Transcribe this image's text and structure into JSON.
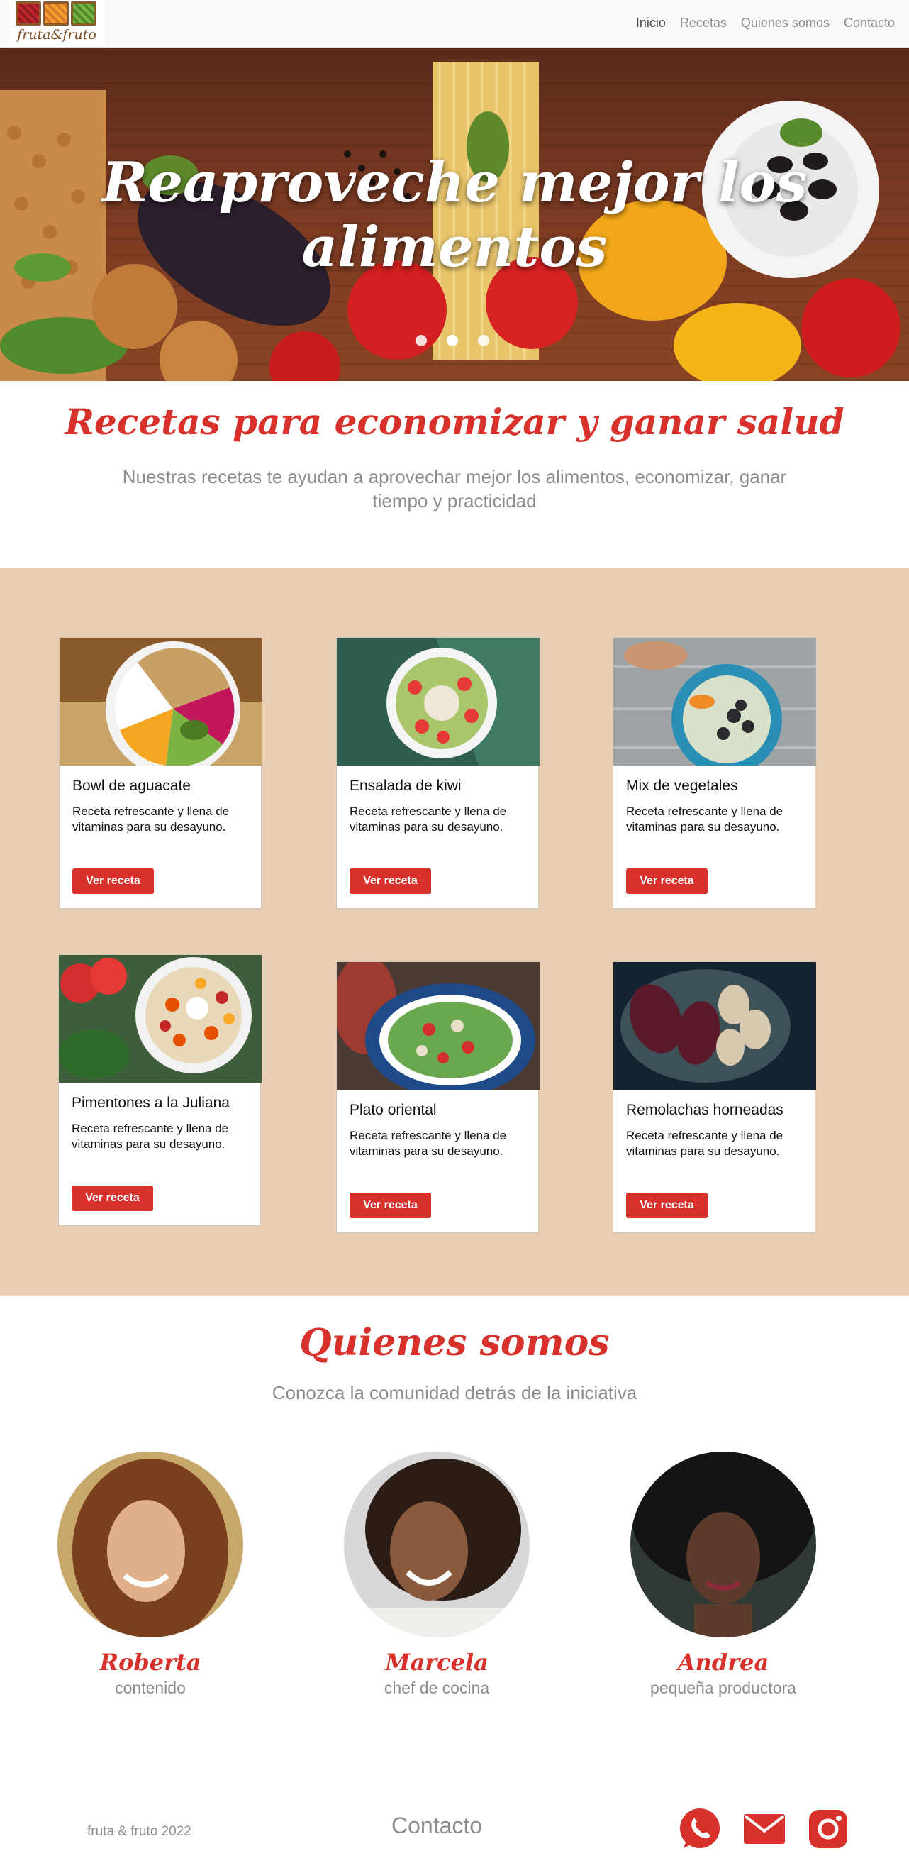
{
  "brand": {
    "logo_text": "fruta&fruto"
  },
  "nav": {
    "items": [
      {
        "label": "Inicio"
      },
      {
        "label": "Recetas"
      },
      {
        "label": "Quienes somos"
      },
      {
        "label": "Contacto"
      }
    ]
  },
  "hero": {
    "title": "Reaproveche mejor los alimentos",
    "slides": 3,
    "active_slide": 1
  },
  "recipes_section": {
    "title": "Recetas para economizar y ganar salud",
    "subtitle": "Nuestras recetas te ayudan a aprovechar mejor los alimentos, economizar, ganar tiempo y practicidad"
  },
  "recipes": [
    {
      "title": "Bowl de aguacate",
      "text": "Receta refrescante y llena de vitaminas para su desayuno.",
      "button": "Ver receta"
    },
    {
      "title": "Ensalada de kiwi",
      "text": "Receta refrescante y llena de vitaminas para su desayuno.",
      "button": "Ver receta"
    },
    {
      "title": "Mix de vegetales",
      "text": "Receta refrescante y llena de vitaminas para su desayuno.",
      "button": "Ver receta"
    },
    {
      "title": "Pimentones a la Juliana",
      "text": "Receta refrescante y llena de vitaminas para su desayuno.",
      "button": "Ver receta"
    },
    {
      "title": "Plato oriental",
      "text": "Receta refrescante y llena de vitaminas para su desayuno.",
      "button": "Ver receta"
    },
    {
      "title": "Remolachas horneadas",
      "text": "Receta refrescante y llena de vitaminas para su desayuno.",
      "button": "Ver receta"
    }
  ],
  "about": {
    "title": "Quienes somos",
    "subtitle": "Conozca la comunidad detrás de la iniciativa",
    "members": [
      {
        "name": "Roberta",
        "role": "contenido"
      },
      {
        "name": "Marcela",
        "role": "chef de cocina"
      },
      {
        "name": "Andrea",
        "role": "pequeña productora"
      }
    ]
  },
  "footer": {
    "copyright": "fruta & fruto 2022",
    "contact_label": "Contacto",
    "social": [
      "whatsapp-icon",
      "email-icon",
      "instagram-icon"
    ]
  },
  "colors": {
    "accent": "#d8302a",
    "band": "#e6cdb3",
    "muted": "#8c8c8c"
  }
}
